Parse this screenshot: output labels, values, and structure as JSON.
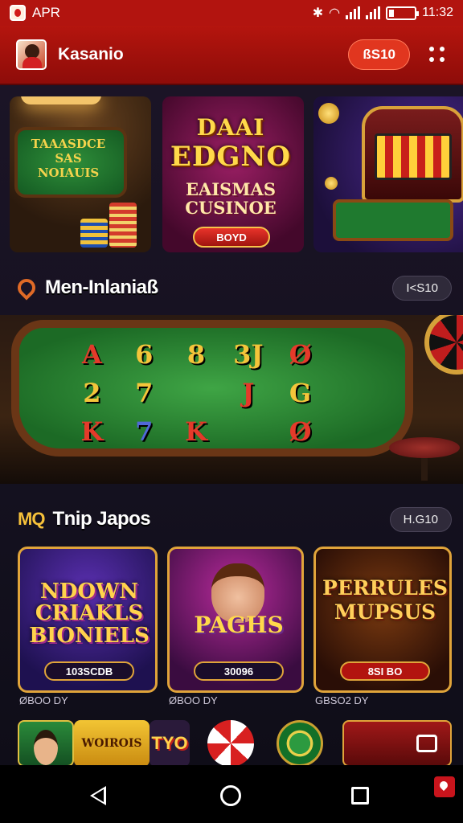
{
  "status_bar": {
    "carrier": "APR",
    "time": "11:32"
  },
  "app_bar": {
    "title": "Kasanio",
    "action_label": "ßЅ10"
  },
  "hero": [
    {
      "line1": "TAAASDCE",
      "line2": "SAS",
      "line3": "NOIAUIS"
    },
    {
      "logo_top": "DAAI",
      "logo_main": "EDGNO",
      "subtitle": "EAISMAS CUSINOE",
      "button": "BOYD"
    },
    {
      "label": "slot-machine"
    }
  ],
  "section1": {
    "title": "Men-Inlaniaß",
    "badge": "I<S10"
  },
  "table_cards": [
    "A",
    "6",
    "8",
    "3J",
    "Ø",
    "2",
    "7",
    "",
    "J",
    "G",
    "K",
    "7",
    "K",
    "",
    "Ø"
  ],
  "section2": {
    "prefix": "MQ",
    "title": "Tnip Japos",
    "badge": "H.G10"
  },
  "games": [
    {
      "art": "NDOWN CRIAKLS BIONIELS",
      "pill": "103SCDB",
      "caption": "ØBOO DY"
    },
    {
      "art": "PAGHS",
      "pill": "30096",
      "caption": "ØBOO DY"
    },
    {
      "art": "PERRULES MUPSUS",
      "pill": "8SI BO",
      "caption": "GBSO2 DY"
    }
  ],
  "mini_row": {
    "m2": "WOIROIS",
    "m3": "TYO"
  },
  "colors": {
    "brand_red": "#b2140f",
    "gold": "#e0a43a",
    "background": "#14111f"
  }
}
